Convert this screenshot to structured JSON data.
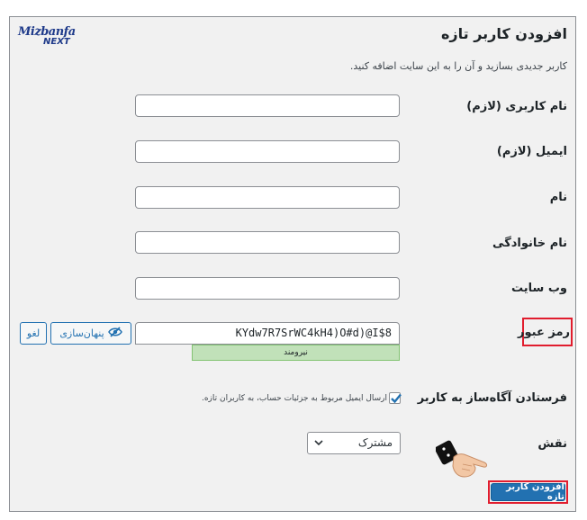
{
  "page": {
    "title": "افزودن کاربر تازه",
    "description": "کاربر جدیدی بسازید و آن را به این سایت اضافه کنید."
  },
  "logo": {
    "line1": "Mizbanfa",
    "line2": "NEXT"
  },
  "form": {
    "username_label": "نام کاربری (لازم)",
    "email_label": "ایمیل (لازم)",
    "firstname_label": "نام",
    "lastname_label": "نام خانوادگی",
    "website_label": "وب سایت",
    "password_label": "رمز عبور",
    "password_value": "KYdw7R7SrWC4kH4)O#d)@I$8",
    "strength_text": "نیرومند",
    "hide_button_label": "پنهان‌سازی",
    "cancel_button_label": "لغو",
    "notify_label": "فرستادن آگاه‌ساز به کاربر",
    "notify_checkbox_text": "ارسال ایمیل مربوط به جزئیات حساب، به کاربران تازه.",
    "notify_checked": true,
    "role_label": "نقش",
    "role_value": "مشترک",
    "submit_label": "افزودن کاربر تازه"
  },
  "colors": {
    "accent": "#2271b1",
    "highlight_border": "#e11d2e",
    "strength_bg": "#c1e1b9"
  },
  "icons": {
    "hide": "eye-slash-icon",
    "chevron": "chevron-down-icon",
    "pointer": "hand-pointer-icon"
  }
}
